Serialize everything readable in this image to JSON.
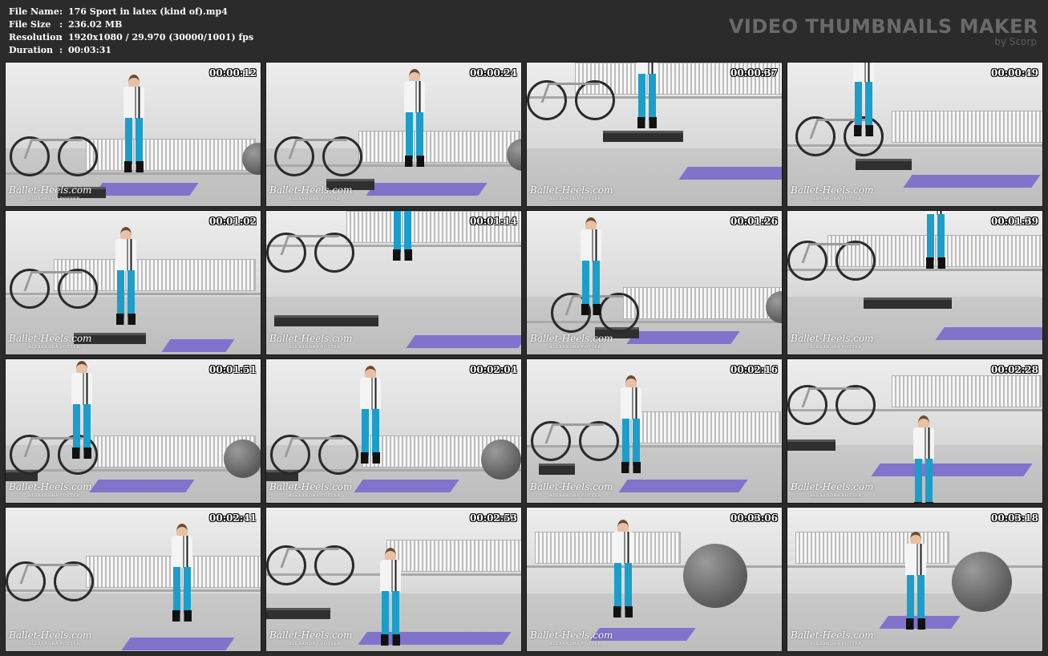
{
  "info": [
    {
      "key": "File Name",
      "sep": ":",
      "value": "176 Sport in latex (kind of).mp4"
    },
    {
      "key": "File Size",
      "sep": ":",
      "value": "236.02 MB"
    },
    {
      "key": "Resolution",
      "sep": ":",
      "value": "1920x1080 / 29.970 (30000/1001) fps"
    },
    {
      "key": "Duration",
      "sep": ":",
      "value": "00:03:31"
    }
  ],
  "brand": {
    "title": "VIDEO THUMBNAILS MAKER",
    "subtitle": "by Scorp"
  },
  "watermark": {
    "name": "Ballet-Heels.com",
    "sub": "ALEXANDRA POTTER"
  },
  "colors": {
    "background": "#2b2b2b",
    "latex": "#1b9ec9",
    "mat": "#8173cc"
  },
  "thumbnails": [
    {
      "time": "00:00:12"
    },
    {
      "time": "00:00:24"
    },
    {
      "time": "00:00:37"
    },
    {
      "time": "00:00:49"
    },
    {
      "time": "00:01:02"
    },
    {
      "time": "00:01:14"
    },
    {
      "time": "00:01:26"
    },
    {
      "time": "00:01:39"
    },
    {
      "time": "00:01:51"
    },
    {
      "time": "00:02:04"
    },
    {
      "time": "00:02:16"
    },
    {
      "time": "00:02:28"
    },
    {
      "time": "00:02:41"
    },
    {
      "time": "00:02:53"
    },
    {
      "time": "00:03:06"
    },
    {
      "time": "00:03:18"
    }
  ]
}
